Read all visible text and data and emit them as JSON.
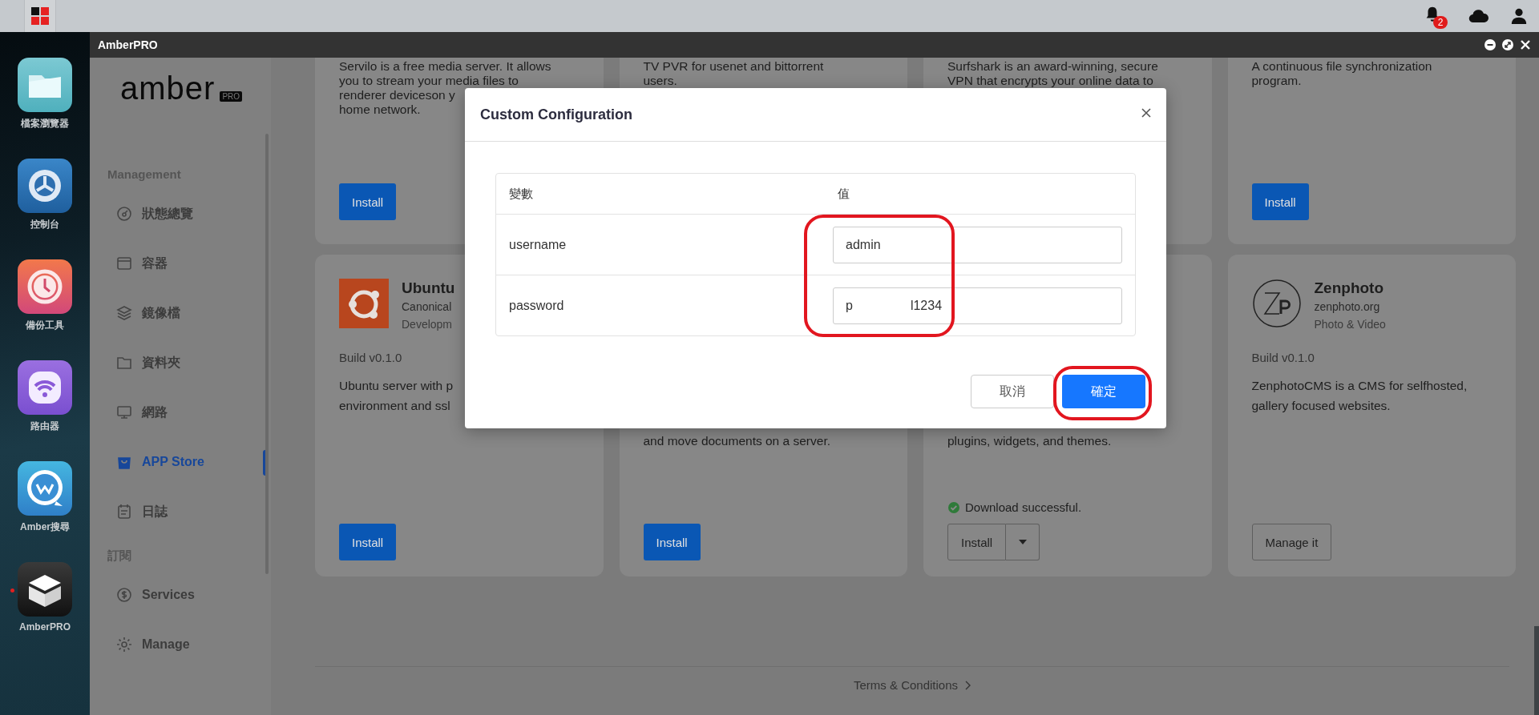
{
  "top_bar": {
    "notification_count": "2"
  },
  "dock": [
    {
      "label": "檔案瀏覽器",
      "running": false
    },
    {
      "label": "控制台",
      "running": false
    },
    {
      "label": "備份工具",
      "running": false
    },
    {
      "label": "路由器",
      "running": false
    },
    {
      "label": "Amber搜尋",
      "running": false
    },
    {
      "label": "AmberPRO",
      "running": true
    }
  ],
  "window": {
    "title": "AmberPRO"
  },
  "sidebar": {
    "logo": "amber",
    "logo_badge": "PRO",
    "sections": [
      {
        "heading": "Management",
        "items": [
          {
            "label": "狀態總覽",
            "selected": false
          },
          {
            "label": "容器",
            "selected": false
          },
          {
            "label": "鏡像檔",
            "selected": false
          },
          {
            "label": "資料夾",
            "selected": false
          },
          {
            "label": "網路",
            "selected": false
          },
          {
            "label": "APP Store",
            "selected": true
          },
          {
            "label": "日誌",
            "selected": false
          }
        ]
      },
      {
        "heading": "訂閱",
        "items": [
          {
            "label": "Services",
            "selected": false
          },
          {
            "label": "Manage",
            "selected": false
          }
        ]
      }
    ]
  },
  "apps": [
    {
      "description": [
        "Servilo is a free media server. It allows",
        "you to stream your media files to",
        "renderer deviceson y",
        "home network."
      ],
      "button": {
        "kind": "primary",
        "label": "Install"
      }
    },
    {
      "description": [
        "TV PVR for usenet and bittorrent",
        "users."
      ]
    },
    {
      "description": [
        "Surfshark is an award-winning, secure",
        "VPN that encrypts your online data to"
      ]
    },
    {
      "description": [
        "A continuous file synchronization",
        "program."
      ],
      "button": {
        "kind": "primary",
        "label": "Install"
      }
    },
    {
      "name": "Ubuntu",
      "publisher": "Canonical",
      "category": "Developm",
      "build": "Build v0.1.0",
      "description": [
        "Ubuntu server with p",
        "environment and ssl"
      ],
      "button": {
        "kind": "primary",
        "label": "Install"
      }
    },
    {
      "description": [
        "and move documents on a server."
      ],
      "button": {
        "kind": "primary",
        "label": "Install"
      }
    },
    {
      "description": [
        "plugins, widgets, and themes."
      ],
      "status": "Download successful.",
      "button": {
        "kind": "split",
        "label": "Install"
      }
    },
    {
      "name": "Zenphoto",
      "publisher": "zenphoto.org",
      "category": "Photo & Video",
      "build": "Build v0.1.0",
      "description": [
        "ZenphotoCMS is a CMS for selfhosted,",
        "gallery focused websites."
      ],
      "button": {
        "kind": "outline",
        "label": "Manage it"
      }
    }
  ],
  "footer": {
    "link": "Terms & Conditions"
  },
  "modal": {
    "title": "Custom Configuration",
    "columns": [
      "變數",
      "值"
    ],
    "rows": [
      {
        "name": "username",
        "value": "admin"
      },
      {
        "name": "password",
        "value": "p",
        "value_tail": "l1234"
      }
    ],
    "value_column_highlighted": true,
    "buttons": [
      {
        "kind": "secondary",
        "label": "取消",
        "highlighted": false
      },
      {
        "kind": "primary",
        "label": "確定",
        "highlighted": true
      }
    ]
  }
}
